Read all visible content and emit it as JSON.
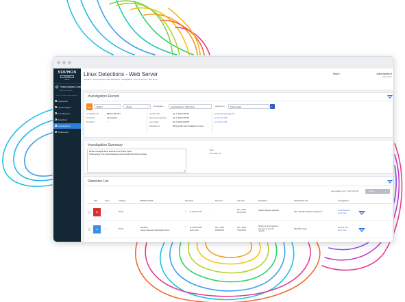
{
  "window": {
    "controls": [
      "close",
      "minimize",
      "maximize"
    ]
  },
  "sidebar": {
    "brand": "SOPHOS",
    "brand_sub": "CENTRAL",
    "role": "Admin",
    "section_title": "Threat Analysis Center",
    "back_link": "Back to Overview",
    "group_label": "DETECTION AND INVESTIGATION",
    "items": [
      {
        "label": "Dashboard",
        "icon": "dashboard-icon"
      },
      {
        "label": "Threat Graphs",
        "icon": "threat-graph-icon"
      },
      {
        "label": "Live Discover",
        "icon": "live-discover-icon"
      },
      {
        "label": "Detections",
        "icon": "detections-icon"
      },
      {
        "label": "Investigations",
        "icon": "investigations-icon"
      },
      {
        "label": "Preferences",
        "icon": "gear-icon"
      }
    ],
    "active_index": 4
  },
  "header": {
    "title": "Linux Detections - Web Server",
    "breadcrumbs": [
      "Overview",
      "Threat Analysis Center Dashboard",
      "Investigations",
      "Linux Detections - Web Server"
    ],
    "help": "Help",
    "user_name": "Administrator",
    "user_role": "Super Admin"
  },
  "record": {
    "heading": "Investigation Record",
    "priority": "Medium",
    "status": "Closed",
    "investigation_label": "Investigation",
    "investigation_value": "Linux Detections - Web Server",
    "assigned_label": "Assigned to",
    "assigned_value": "Tyanne asago",
    "id_label": "Investigation ID",
    "id_value": "8803-0c-d67-821",
    "created_by_label": "Created by",
    "created_by_value": "Administrator",
    "detections_label": "Detections",
    "detections_value": "7",
    "creation_date_label": "Creation date",
    "creation_date_value": "Apr 7, 2022 3:39 PM",
    "recent_label": "Most recent detection",
    "recent_value": "Apr 7, 2022 3:47 PM",
    "last_update_label": "Last update",
    "last_update_value": "Apr 7, 2022 3:43 PM",
    "retention_label": "Data lasts for",
    "retention_value": "30 days after the investigation is closed",
    "devices_label": "Devices (as pre-built): 15",
    "devices": [
      "ip-172-31-3-118",
      "ip-172-31-4-176"
    ]
  },
  "summary": {
    "heading": "Investigation Summary",
    "text": "Please investigate these detections from Public Cloud.\nThese appear to be active adversary scanning and brute forcing activities.",
    "more_label": "More",
    "view_audit": "View audit trail"
  },
  "detections": {
    "heading": "Detection List",
    "last_updated": "Last updated: Apr 7, 2022 3:42 PM",
    "actions_label": "Actions",
    "columns": [
      "Risk",
      "Score",
      "Category",
      "MITRE ATT&CK",
      "Device list",
      "First seen",
      "Last seen",
      "Description",
      "Classification rule",
      "Investigations"
    ],
    "rows": [
      {
        "risk": "8",
        "risk_color": "#d6312e",
        "score": "1",
        "category": "Threat",
        "mitre": "",
        "device": "ip-172-31-4-176",
        "first_seen": "-",
        "last_seen": "Apr 1, 2022\n8:07:24 PM",
        "description": "Sophos Detected malicious",
        "rule": "SPL-LNX-604-Suspicious Program N...",
        "investigations": "Linux Detections\nand 1 more"
      },
      {
        "risk": "4",
        "risk_color": "#3c8fe0",
        "score": "6",
        "category": "Threat",
        "mitre": "Discovery\nSystem Network Configuration Discov...",
        "device": "ip-172-31-3-118\nand 1 more",
        "first_seen": "Apr 1, 2022\n8:06:58 PM",
        "last_seen": "Apr 1, 2022\n7:52:05 PM",
        "description": "Nmap is a reconnaissance\ntool used to scan the\nnetwork.",
        "rule": "DSL-6907-nmap",
        "investigations": "Network scan\nand 1 more"
      }
    ]
  },
  "colors": {
    "sidebar": "#142735",
    "accent": "#2d7fd9",
    "priority": "#f08a24",
    "link": "#1f6fd6"
  }
}
